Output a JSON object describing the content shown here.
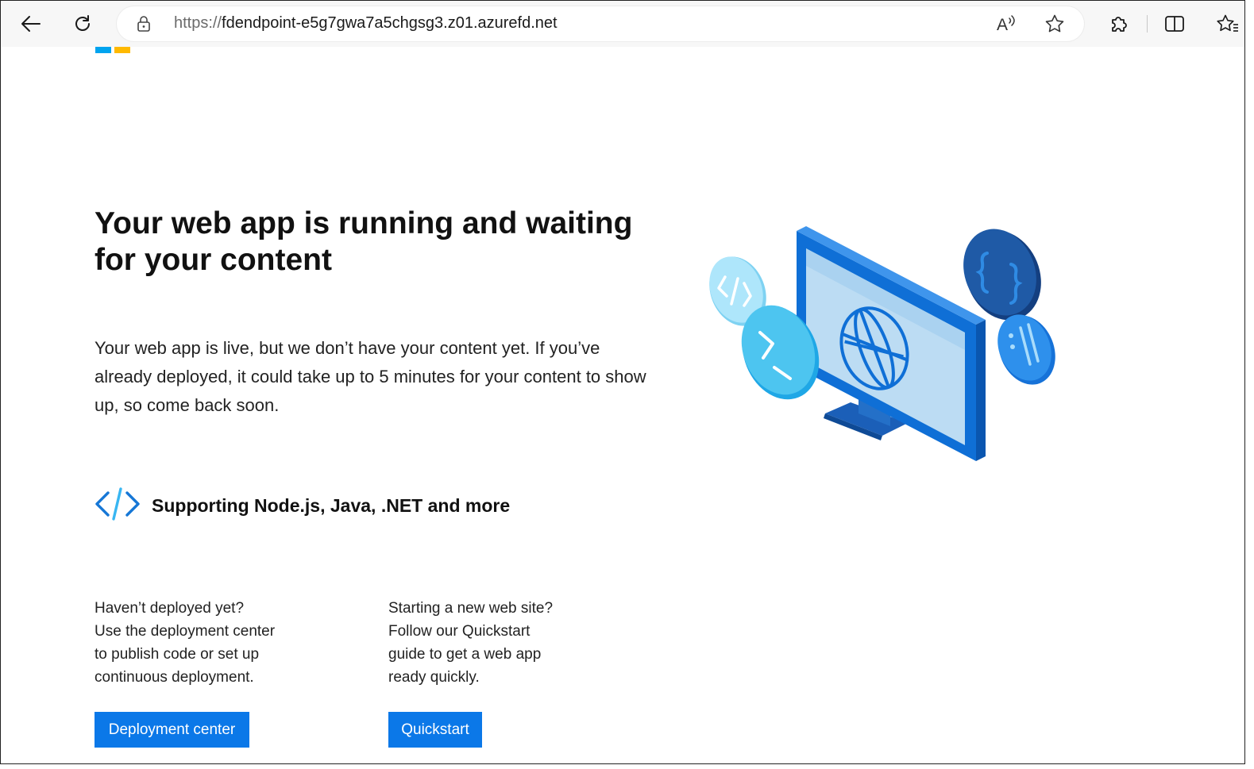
{
  "browser": {
    "url_protocol": "https://",
    "url_host": "fdendpoint-e5g7gwa7a5chgsg3.z01.azurefd.net",
    "read_aloud_label": "A"
  },
  "page": {
    "headline": "Your web app is running and waiting for your content",
    "body": "Your web app is live, but we don’t have your content yet. If you’ve already deployed, it could take up to 5 minutes for your content to show up, so come back soon.",
    "support_text": "Supporting Node.js, Java, .NET and more",
    "left_column": {
      "lines": [
        "Haven’t deployed yet?",
        "Use the deployment center",
        "to publish code or set up",
        "continuous deployment."
      ],
      "button_label": "Deployment center"
    },
    "right_column": {
      "lines": [
        "Starting a new web site?",
        "Follow our Quickstart",
        "guide to get a web app",
        "ready quickly."
      ],
      "button_label": "Quickstart"
    }
  },
  "colors": {
    "button_blue": "#0b78e8",
    "logo_blue": "#00a4ef",
    "logo_yellow": "#ffb900"
  }
}
